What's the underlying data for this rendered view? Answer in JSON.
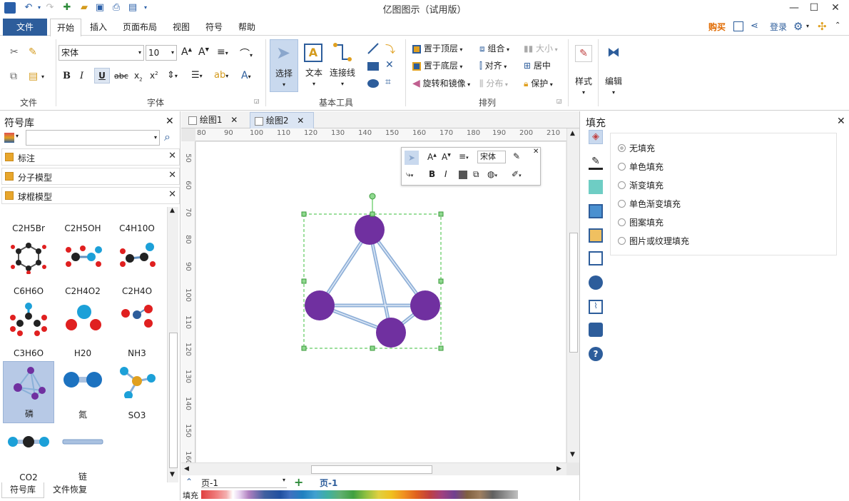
{
  "window": {
    "title": "亿图图示（试用版）"
  },
  "menubar": {
    "file": "文件",
    "items": [
      "开始",
      "插入",
      "页面布局",
      "视图",
      "符号",
      "帮助"
    ],
    "right": {
      "buy": "购买",
      "login": "登录"
    }
  },
  "ribbon": {
    "groups": {
      "file": "文件",
      "font": "字体",
      "basic_tools": "基本工具",
      "arrange": "排列",
      "style": "样式",
      "edit": "编辑"
    },
    "font_name": "宋体",
    "font_size": "10",
    "tools": {
      "select": "选择",
      "text": "文本",
      "connector": "连接线"
    },
    "arrange": {
      "to_top": "置于顶层",
      "to_bottom": "置于底层",
      "rotate": "旋转和镜像",
      "group": "组合",
      "align": "对齐",
      "distribute": "分布",
      "size": "大小",
      "center": "居中",
      "protect": "保护"
    }
  },
  "library": {
    "title": "符号库",
    "categories": [
      "标注",
      "分子模型",
      "球棍模型"
    ],
    "symbols": [
      {
        "label": "C2H5Br"
      },
      {
        "label": "C2H5OH"
      },
      {
        "label": "C4H10O"
      },
      {
        "label": "C6H6O"
      },
      {
        "label": "C2H4O2"
      },
      {
        "label": "C2H4O"
      },
      {
        "label": "C3H6O"
      },
      {
        "label": "H20"
      },
      {
        "label": "NH3"
      },
      {
        "label": "磷"
      },
      {
        "label": "氮"
      },
      {
        "label": "SO3"
      },
      {
        "label": "CO2"
      },
      {
        "label": "链"
      }
    ],
    "bottom_tabs": [
      "符号库",
      "文件恢复"
    ]
  },
  "tabs": [
    {
      "label": "绘图1"
    },
    {
      "label": "绘图2"
    }
  ],
  "ruler": {
    "h": [
      "80",
      "90",
      "100",
      "110",
      "120",
      "130",
      "140",
      "150",
      "160",
      "170",
      "180",
      "190",
      "200",
      "210"
    ],
    "v": [
      "50",
      "60",
      "70",
      "80",
      "90",
      "100",
      "110",
      "120",
      "130",
      "140",
      "150",
      "160"
    ]
  },
  "floating_toolbar": {
    "font": "宋体"
  },
  "fill_panel": {
    "title": "填充",
    "options": [
      "无填充",
      "单色填充",
      "渐变填充",
      "单色渐变填充",
      "图案填充",
      "图片或纹理填充"
    ],
    "selected": "无填充"
  },
  "statusbar": {
    "page_select": "页-1",
    "page_tab": "页-1",
    "fill_label": "填充"
  },
  "colors": {
    "accent": "#2d5d9b",
    "atom": "#7030a0",
    "bond": "#a9c1e0"
  }
}
